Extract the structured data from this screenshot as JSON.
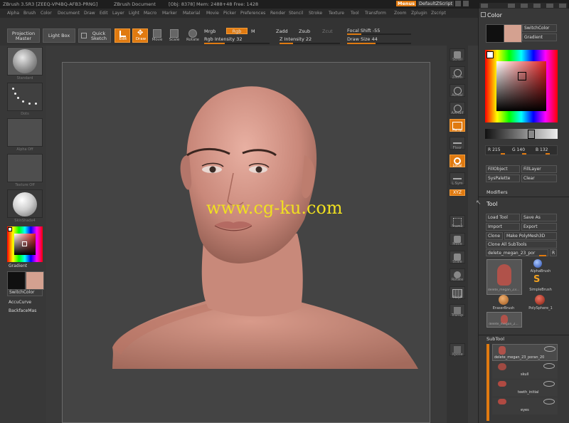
{
  "title_bar": {
    "app": "ZBrush 3.5R3 [ZEEQ-VP4BQ-AFB3-PRNG]",
    "doc": "ZBrush Document",
    "stats": "[Obj: 8378] Mem: 2488+48 Free: 1428",
    "menus_label": "Menus",
    "script_label": "DefaultZScript"
  },
  "menus": [
    "Alpha",
    "Brush",
    "Color",
    "Document",
    "Draw",
    "Edit",
    "Layer",
    "Light",
    "Macro",
    "Marker",
    "Material",
    "Movie",
    "Picker",
    "Preferences",
    "Render",
    "Stencil",
    "Stroke",
    "Texture",
    "Tool",
    "Transform",
    "Zoom",
    "Zplugin",
    "Zscript"
  ],
  "toolbar": {
    "projection_master": "Projection Master",
    "light_box": "Light Box",
    "quick_sketch": "Quick Sketch",
    "edit": "Edit",
    "draw": "Draw",
    "move": "Move",
    "scale": "Scale",
    "rotate": "Rotate",
    "mrgb": "Mrgb",
    "rgb": "Rgb",
    "m": "M",
    "zadd": "Zadd",
    "zsub": "Zsub",
    "zcut": "Zcut",
    "rgb_intensity": "Rgb Intensity 32",
    "rgb_intensity_value": 32,
    "z_intensity": "Z Intensity 22",
    "z_intensity_value": 22,
    "focal_shift": "Focal Shift -55",
    "focal_shift_value": -55,
    "draw_size": "Draw Size 44",
    "draw_size_value": 44
  },
  "left_panel": {
    "brush_label": "Standard",
    "stroke_label": "Dots",
    "alpha_label": "Alpha Off",
    "texture_label": "Texture Off",
    "material_label": "SkinShade4",
    "gradient": "Gradient",
    "switch_color": "SwitchColor",
    "accu_curve": "AccuCurve",
    "backface_mask": "BackfaceMas"
  },
  "right_strip": [
    "Scroll",
    "Zoom",
    "Actual",
    "AAHalf",
    "Persp",
    "Floor",
    "Local",
    "L.Sym",
    "Frame",
    "Move",
    "Scale",
    "Rotate",
    "PolyF",
    "Transp",
    "Ghost",
    "Solo",
    "Xpose"
  ],
  "xyz_label": "XYZ",
  "watermark": "www.cg-ku.com",
  "color_tray": {
    "title": "Color",
    "switch_color": "SwitchColor",
    "gradient": "Gradient",
    "r": "R 215",
    "g": "G 140",
    "b": "B 132",
    "fill_object": "FillObject",
    "fill_layer": "FillLayer",
    "sys_palette": "SysPalette",
    "clear": "Clear",
    "main_color": "#d4a190"
  },
  "modifiers_label": "Modifiers",
  "tool_tray": {
    "title": "Tool",
    "load_tool": "Load Tool",
    "save_as": "Save As",
    "import": "Import",
    "export": "Export",
    "clone": "Clone",
    "make_polymesh": "Make PolyMesh3D",
    "clone_all": "Clone All SubTools",
    "current_tool": "delete_megan_23_por",
    "r_btn": "R",
    "tools": [
      {
        "name": "delete_megan_23..."
      },
      {
        "name": "AlphaBrush"
      },
      {
        "name": "SimpleBrush"
      },
      {
        "name": "EraserBrush"
      },
      {
        "name": "PolySphere_1"
      },
      {
        "name": "delete_megan_2..."
      }
    ]
  },
  "subtool": {
    "title": "SubTool",
    "items": [
      {
        "name": "delete_megan_23_poran_20"
      },
      {
        "name": "skull"
      },
      {
        "name": "teeth_initial"
      },
      {
        "name": "eyes"
      }
    ]
  }
}
